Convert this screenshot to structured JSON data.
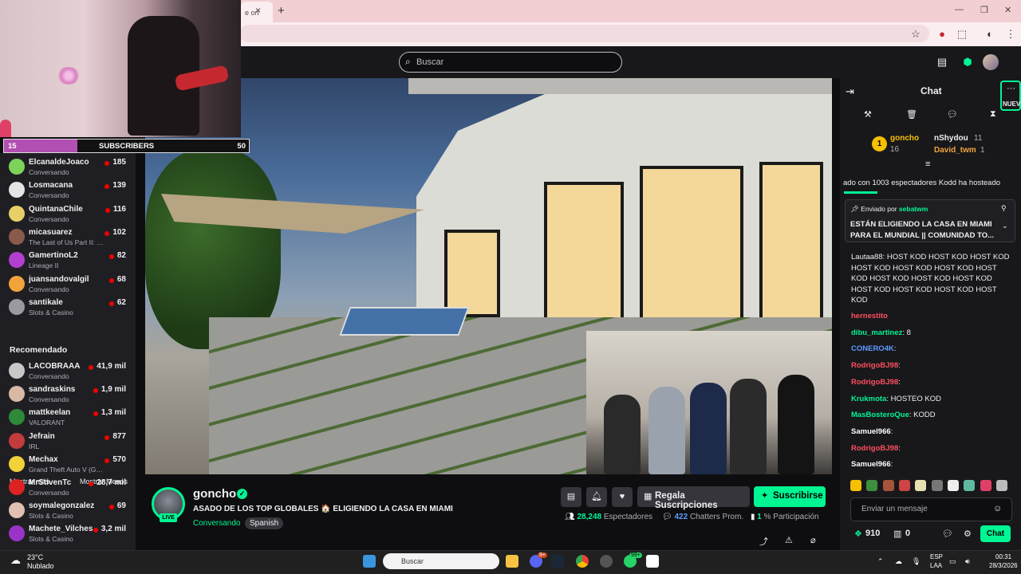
{
  "browser": {
    "tab_label": "e on",
    "tab_close": "×",
    "new_tab": "+"
  },
  "twitch_nav": {
    "search_placeholder": "Buscar"
  },
  "sub_goal": {
    "current": "15",
    "label": "SUBSCRIBERS",
    "target": "50",
    "progress": 0.3
  },
  "sidebar": {
    "followed": [
      {
        "name": "ElcanaldeJoaco",
        "game": "Conversando",
        "viewers": "185",
        "color": "#7dd35a"
      },
      {
        "name": "Losmacana",
        "game": "Conversando",
        "viewers": "139",
        "color": "#e5e5e5"
      },
      {
        "name": "QuintanaChile",
        "game": "Conversando",
        "viewers": "116",
        "color": "#e8d066"
      },
      {
        "name": "micasuarez",
        "game": "The Last of Us Part II: Remastered",
        "viewers": "102",
        "color": "#8a5a4a"
      },
      {
        "name": "GamertinoL2",
        "game": "Lineage II",
        "viewers": "82",
        "color": "#b33fd1"
      },
      {
        "name": "juansandovalgil",
        "game": "Conversando",
        "viewers": "68",
        "color": "#f2a43a"
      },
      {
        "name": "santikale",
        "game": "Slots & Casino",
        "viewers": "62",
        "color": "#9a9aa0"
      }
    ],
    "show_more": "Mostrar más",
    "show_less": "Mostrar Menos",
    "recommended_header": "Recomendado",
    "recommended": [
      {
        "name": "LACOBRAAA",
        "game": "Conversando",
        "viewers": "41,9 mil",
        "color": "#c8c8c8"
      },
      {
        "name": "sandraskins",
        "game": "Conversando",
        "viewers": "1,9 mil",
        "color": "#d9b9a6"
      },
      {
        "name": "mattkeelan",
        "game": "VALORANT",
        "viewers": "1,3 mil",
        "color": "#2e8a3a"
      },
      {
        "name": "Jefrain",
        "game": "IRL",
        "viewers": "877",
        "color": "#c43b3b"
      },
      {
        "name": "Mechax",
        "game": "Grand Theft Auto V (GTA V)",
        "viewers": "570",
        "color": "#f0d23a"
      },
      {
        "name": "MrStivenTc",
        "game": "Conversando",
        "viewers": "28,7 mil",
        "color": "#d22"
      },
      {
        "name": "soymalegonzalez",
        "game": "Slots & Casino",
        "viewers": "69",
        "color": "#e0c0b0"
      },
      {
        "name": "Machete_Vilches",
        "game": "Slots & Casino",
        "viewers": "3,2 mil",
        "color": "#9b33c9"
      }
    ]
  },
  "channel": {
    "live_badge": "LIVE",
    "name": "goncho",
    "verified": "✓",
    "title": "ASADO DE LOS TOP GLOBALES 🏠 ELIGIENDO LA CASA EN MIAMI",
    "category": "Conversando",
    "tag": "Spanish",
    "gift_label": "Regala Suscripciones",
    "subscribe_label": "Suscribirse",
    "viewers_value": "28,248",
    "viewers_label": "Espectadores",
    "chatters_value": "422",
    "chatters_label": "Chatters Prom.",
    "participation_value": "1",
    "participation_label": "% Participación"
  },
  "chat": {
    "title": "Chat",
    "nuev_label": "NUEV",
    "leaders": {
      "rank": "1",
      "first": {
        "name": "goncho",
        "count": "16"
      },
      "second": {
        "name": "nShydou",
        "count": "11"
      },
      "third": {
        "name": "David_twm",
        "count": "1"
      }
    },
    "hype_line": "ado con 1003 espectadores  Kodd ha hosteado",
    "pinned_by_label": "Enviado por",
    "pinned_by_user": "sebatwm",
    "pinned_message": "ESTÁN ELIGIENDO LA CASA EN MIAMI PARA EL MUNDIAL || COMUNIDAD TO...",
    "host_block": "Lautaa88: HOST KOD  HOST KOD  HOST KOD  HOST KOD  HOST KOD  HOST KOD  HOST KOD  HOST KOD  HOST KOD  HOST KOD  HOST KOD  HOST KOD  HOST KOD  HOST KOD",
    "messages": [
      {
        "user": "hernestito",
        "text": "",
        "color": "#ff4f5e"
      },
      {
        "user": "dibu_martinez",
        "text": ": 8",
        "color": "#00f593"
      },
      {
        "user": "CONERO4K",
        "text": ":",
        "color": "#5d9cff"
      },
      {
        "user": "RodrigoBJ98",
        "text": ":",
        "color": "#ff4f5e"
      },
      {
        "user": "RodrigoBJ98",
        "text": ":",
        "color": "#ff4f5e"
      },
      {
        "user": "Krukmota",
        "text": ": HOSTEO KOD",
        "color": "#00f593"
      },
      {
        "user": "MasBosteroQue",
        "text": ": KODD",
        "color": "#00f593"
      },
      {
        "user": "Samuel966",
        "text": ":",
        "color": "#ffffff"
      },
      {
        "user": "RodrigoBJ98",
        "text": ":",
        "color": "#ff4f5e"
      },
      {
        "user": "Samuel966",
        "text": ":",
        "color": "#ffffff"
      }
    ],
    "input_placeholder": "Enviar un mensaje",
    "points": "910",
    "drops": "0",
    "send_label": "Chat"
  },
  "taskbar": {
    "weather_temp": "23°C",
    "weather_desc": "Nublado",
    "search_placeholder": "Buscar",
    "lang_top": "ESP",
    "lang_bottom": "LAA",
    "time": "00:31",
    "date": "28/3/2026",
    "discord_badge": "9+",
    "whatsapp_badge": "99+"
  },
  "colors": {
    "accent": "#00f593",
    "background": "#0e0e10",
    "panel": "#18181b"
  }
}
